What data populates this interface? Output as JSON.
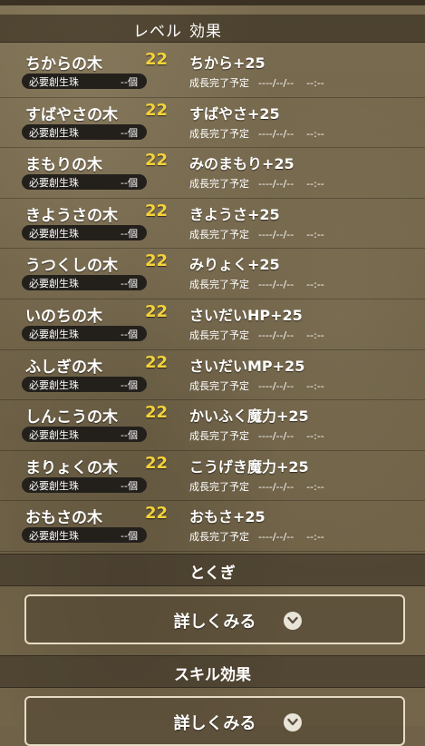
{
  "header": {
    "level_label": "レベル",
    "effect_label": "効果"
  },
  "rows": [
    {
      "name": "ちからの木",
      "level": "22",
      "effect": "ちから+25",
      "req_label": "必要創生珠",
      "req_value": "--個",
      "growth_label": "成長完了予定",
      "growth_date": "----/--/--",
      "growth_time": "--:--"
    },
    {
      "name": "すばやさの木",
      "level": "22",
      "effect": "すばやさ+25",
      "req_label": "必要創生珠",
      "req_value": "--個",
      "growth_label": "成長完了予定",
      "growth_date": "----/--/--",
      "growth_time": "--:--"
    },
    {
      "name": "まもりの木",
      "level": "22",
      "effect": "みのまもり+25",
      "req_label": "必要創生珠",
      "req_value": "--個",
      "growth_label": "成長完了予定",
      "growth_date": "----/--/--",
      "growth_time": "--:--"
    },
    {
      "name": "きようさの木",
      "level": "22",
      "effect": "きようさ+25",
      "req_label": "必要創生珠",
      "req_value": "--個",
      "growth_label": "成長完了予定",
      "growth_date": "----/--/--",
      "growth_time": "--:--"
    },
    {
      "name": "うつくしの木",
      "level": "22",
      "effect": "みりょく+25",
      "req_label": "必要創生珠",
      "req_value": "--個",
      "growth_label": "成長完了予定",
      "growth_date": "----/--/--",
      "growth_time": "--:--"
    },
    {
      "name": "いのちの木",
      "level": "22",
      "effect": "さいだいHP+25",
      "req_label": "必要創生珠",
      "req_value": "--個",
      "growth_label": "成長完了予定",
      "growth_date": "----/--/--",
      "growth_time": "--:--"
    },
    {
      "name": "ふしぎの木",
      "level": "22",
      "effect": "さいだいMP+25",
      "req_label": "必要創生珠",
      "req_value": "--個",
      "growth_label": "成長完了予定",
      "growth_date": "----/--/--",
      "growth_time": "--:--"
    },
    {
      "name": "しんこうの木",
      "level": "22",
      "effect": "かいふく魔力+25",
      "req_label": "必要創生珠",
      "req_value": "--個",
      "growth_label": "成長完了予定",
      "growth_date": "----/--/--",
      "growth_time": "--:--"
    },
    {
      "name": "まりょくの木",
      "level": "22",
      "effect": "こうげき魔力+25",
      "req_label": "必要創生珠",
      "req_value": "--個",
      "growth_label": "成長完了予定",
      "growth_date": "----/--/--",
      "growth_time": "--:--"
    },
    {
      "name": "おもさの木",
      "level": "22",
      "effect": "おもさ+25",
      "req_label": "必要創生珠",
      "req_value": "--個",
      "growth_label": "成長完了予定",
      "growth_date": "----/--/--",
      "growth_time": "--:--"
    }
  ],
  "tokugi": {
    "title": "とくぎ",
    "button_label": "詳しくみる"
  },
  "skill_effect": {
    "title": "スキル効果",
    "button_label": "詳しくみる"
  },
  "icons": {
    "expand": "chevron-down-icon"
  },
  "colors": {
    "level_text": "#f4d23a",
    "pill_bg": "#23201c",
    "button_border": "#e6dcc6"
  }
}
